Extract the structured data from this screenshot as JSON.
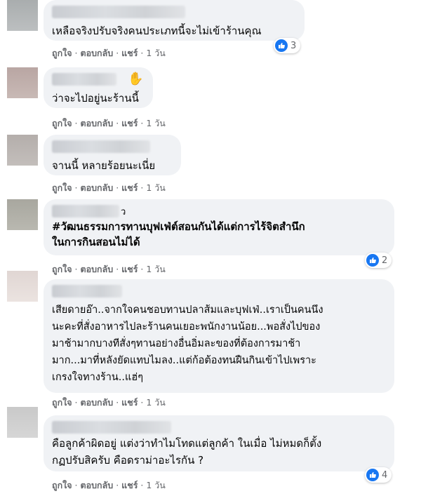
{
  "labels": {
    "like": "ถูกใจ",
    "reply": "ตอบกลับ",
    "share": "แชร์",
    "sep": " · "
  },
  "comments": [
    {
      "text": "เหลือจริงปรับจริงคนประเภทนี้จะไม่เข้าร้านคุณ",
      "time": "1 วัน",
      "reactions": "3"
    },
    {
      "text": "ว่าจะไปอยู่นะร้านนี้",
      "time": "1 วัน",
      "reactions": ""
    },
    {
      "text": "จานนี้ หลายร้อยนะเนี่ย",
      "time": "1 วัน",
      "reactions": ""
    },
    {
      "text": "#วัฒนธรรมการทานบุฟเฟ่ต์สอนกันได้แต่การไร้จิตสำนึก\nในการกินสอนไม่ได้",
      "time": "1 วัน",
      "reactions": "2",
      "name_suffix": "ว"
    },
    {
      "text": "เสียดายอ๊า..จากใจคนชอบทานปลาส้มและบุฟเฟ่..เราเป็นคนนึง\nนะคะที่สั่งอาหารไปละร้านคนเยอะพนักงานน้อย...พอสั่งไปของ\nมาช้ามากบางทีสั่งๆทานอย่างอื่นอิ่มละของที่ต้องการมาช้า\nมาก...มาที่หลังยัดแทบไมลง..แต่ก้อต้องทนฝืนกินเข้าไปเพราะ\nเกรงใจทางร้าน..แฮ่ๆ",
      "time": "1 วัน",
      "reactions": ""
    },
    {
      "text": "คือลูกค้าผิดอยู่ แต่งว่าทำไมโทดแต่ลูกค้า ในเมื่อ ไม่หมดก็ตั้ง\nกฏปรับสิครับ คือดราม่าอะไรกัน ?",
      "time": "1 วัน",
      "reactions": "4"
    }
  ],
  "colors": {
    "bubble": "#f0f2f5",
    "meta": "#65676b",
    "like": "#1877f2"
  }
}
